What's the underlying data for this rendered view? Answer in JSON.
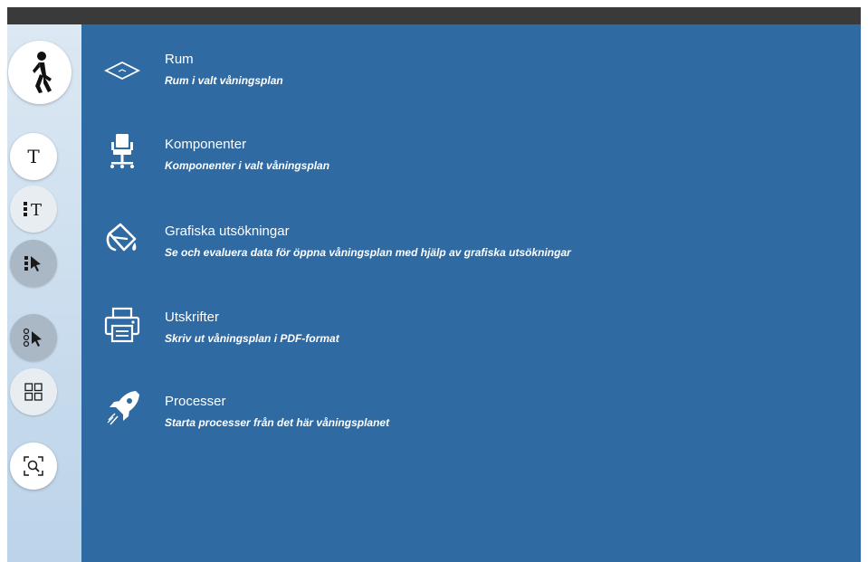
{
  "colors": {
    "topbar": "#3a3a3a",
    "main_bg": "#2f6aa3",
    "sidebar_bg": "#cfe0ef",
    "text": "#ffffff"
  },
  "sidebar": {
    "buttons": [
      {
        "name": "walk-mode",
        "icon": "walking-person-icon"
      },
      {
        "name": "text-tool",
        "icon": "text-t-icon"
      },
      {
        "name": "text-list-tool",
        "icon": "text-list-icon"
      },
      {
        "name": "select-list-tool",
        "icon": "select-pointer-list-icon"
      },
      {
        "name": "multi-select-tool",
        "icon": "pointer-nodes-icon"
      },
      {
        "name": "grid-view",
        "icon": "grid-icon"
      },
      {
        "name": "zoom-search",
        "icon": "scan-search-icon"
      }
    ]
  },
  "menu": {
    "items": [
      {
        "title": "Rum",
        "desc": "Rum i valt våningsplan",
        "icon": "room-floor-icon"
      },
      {
        "title": "Komponenter",
        "desc": "Komponenter i valt våningsplan",
        "icon": "office-chair-icon"
      },
      {
        "title": "Grafiska utsökningar",
        "desc": "Se och evaluera data för öppna våningsplan med hjälp av grafiska utsökningar",
        "icon": "paint-bucket-icon"
      },
      {
        "title": "Utskrifter",
        "desc": "Skriv ut våningsplan i PDF-format",
        "icon": "printer-icon"
      },
      {
        "title": "Processer",
        "desc": "Starta processer från det här våningsplanet",
        "icon": "rocket-icon"
      }
    ]
  }
}
